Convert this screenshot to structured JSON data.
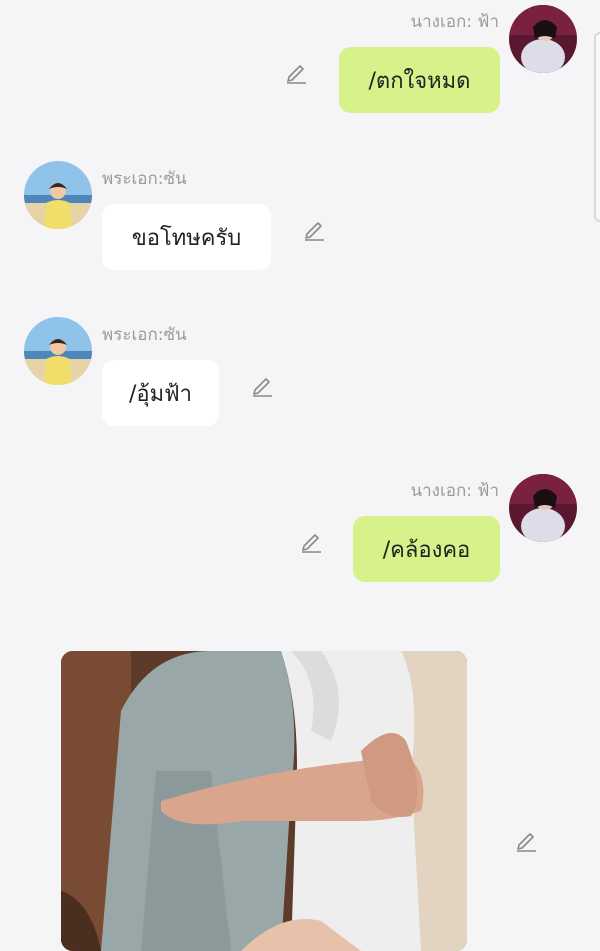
{
  "messages": [
    {
      "sender": "นางเอก: ฟ้า",
      "text": "/ตกใจหมด",
      "side": "right"
    },
    {
      "sender": "พระเอก:ซัน",
      "text": "ขอโทษครับ",
      "side": "left"
    },
    {
      "sender": "พระเอก:ซัน",
      "text": "/อุ้มฟ้า",
      "side": "left"
    },
    {
      "sender": "นางเอก: ฟ้า",
      "text": "/คล้องคอ",
      "side": "right"
    }
  ],
  "colors": {
    "background": "#f5f5f7",
    "my_bubble": "#d7f28a",
    "their_bubble": "#ffffff",
    "sender_name": "#9b9b9b"
  },
  "icons": {
    "edit": "pencil-icon"
  }
}
